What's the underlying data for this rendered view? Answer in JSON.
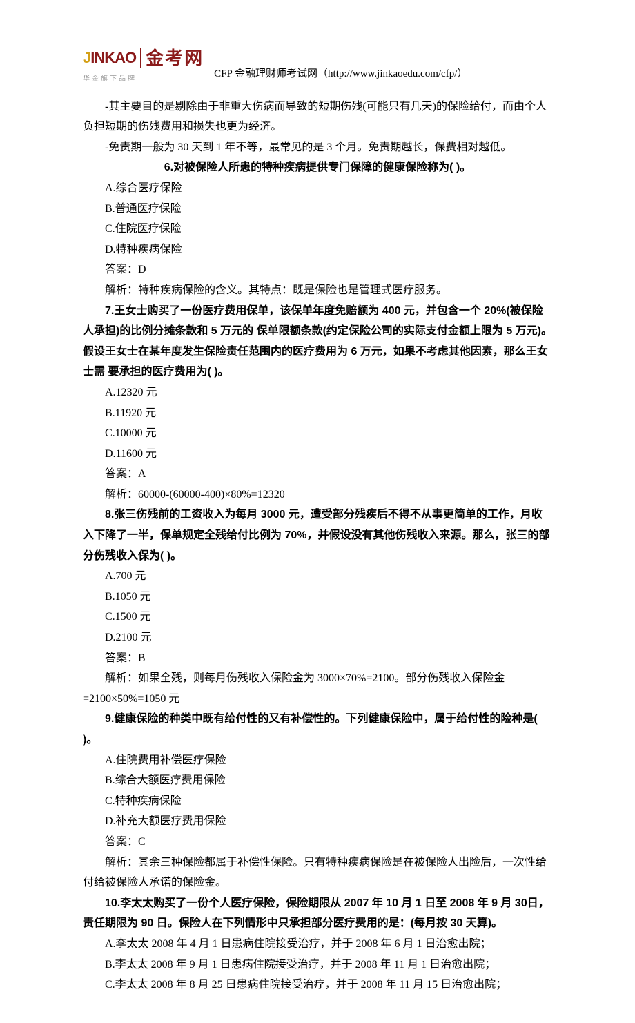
{
  "header": {
    "logo_en_j": "J",
    "logo_en_rest": "INKAO",
    "logo_cn": "金考网",
    "logo_sub": "华金旗下品牌",
    "right_text": "CFP 金融理财师考试网（http://www.jinkaoedu.com/cfp/）"
  },
  "intro": {
    "p1": "-其主要目的是剔除由于非重大伤病而导致的短期伤残(可能只有几天)的保险给付，而由个人负担短期的伤残费用和损失也更为经济。",
    "p2": "-免责期一般为 30 天到 1 年不等，最常见的是 3 个月。免责期越长，保费相对越低。"
  },
  "q6": {
    "stem": "6.对被保险人所患的特种疾病提供专门保障的健康保险称为(  )。",
    "a": "A.综合医疗保险",
    "b": "B.普通医疗保险",
    "c": "C.住院医疗保险",
    "d": "D.特种疾病保险",
    "ans": "答案：D",
    "exp": "解析：特种疾病保险的含义。其特点：既是保险也是管理式医疗服务。"
  },
  "q7": {
    "stem": "7.王女士购买了一份医疗费用保单，该保单年度免赔额为 400 元，并包含一个 20%(被保险人承担)的比例分摊条款和 5 万元的 保单限额条款(约定保险公司的实际支付金额上限为 5 万元)。假设王女士在某年度发生保险责任范围内的医疗费用为 6 万元，如果不考虑其他因素，那么王女士需 要承担的医疗费用为(  )。",
    "a": "A.12320 元",
    "b": "B.11920 元",
    "c": "C.10000 元",
    "d": "D.11600 元",
    "ans": "答案：A",
    "exp": "解析：60000-(60000-400)×80%=12320"
  },
  "q8": {
    "stem": "8.张三伤残前的工资收入为每月 3000 元，遭受部分残疾后不得不从事更简单的工作，月收入下降了一半，保单规定全残给付比例为 70%，并假设没有其他伤残收入来源。那么，张三的部分伤残收入保为(  )。",
    "a": "A.700 元",
    "b": "B.1050 元",
    "c": "C.1500 元",
    "d": "D.2100 元",
    "ans": "答案：B",
    "exp": "解析：如果全残，则每月伤残收入保险金为 3000×70%=2100。部分伤残收入保险金=2100×50%=1050 元"
  },
  "q9": {
    "stem": "9.健康保险的种类中既有给付性的又有补偿性的。下列健康保险中，属于给付性的险种是(  )。",
    "a": "A.住院费用补偿医疗保险",
    "b": "B.综合大额医疗费用保险",
    "c": "C.特种疾病保险",
    "d": "D.补充大额医疗费用保险",
    "ans": "答案：C",
    "exp": "解析：其余三种保险都属于补偿性保险。只有特种疾病保险是在被保险人出险后，一次性给付给被保险人承诺的保险金。"
  },
  "q10": {
    "stem": "10.李太太购买了一份个人医疗保险，保险期限从 2007 年 10 月 1 日至 2008 年 9 月 30日，责任期限为 90 日。保险人在下列情形中只承担部分医疗费用的是：(每月按 30 天算)。",
    "a": "A.李太太 2008 年 4 月 1 日患病住院接受治疗，并于 2008 年 6 月 1 日治愈出院；",
    "b": "B.李太太 2008 年 9 月 1 日患病住院接受治疗，并于 2008 年 11 月 1 日治愈出院；",
    "c": "C.李太太 2008 年 8 月 25 日患病住院接受治疗，并于 2008 年 11 月 15 日治愈出院；"
  }
}
